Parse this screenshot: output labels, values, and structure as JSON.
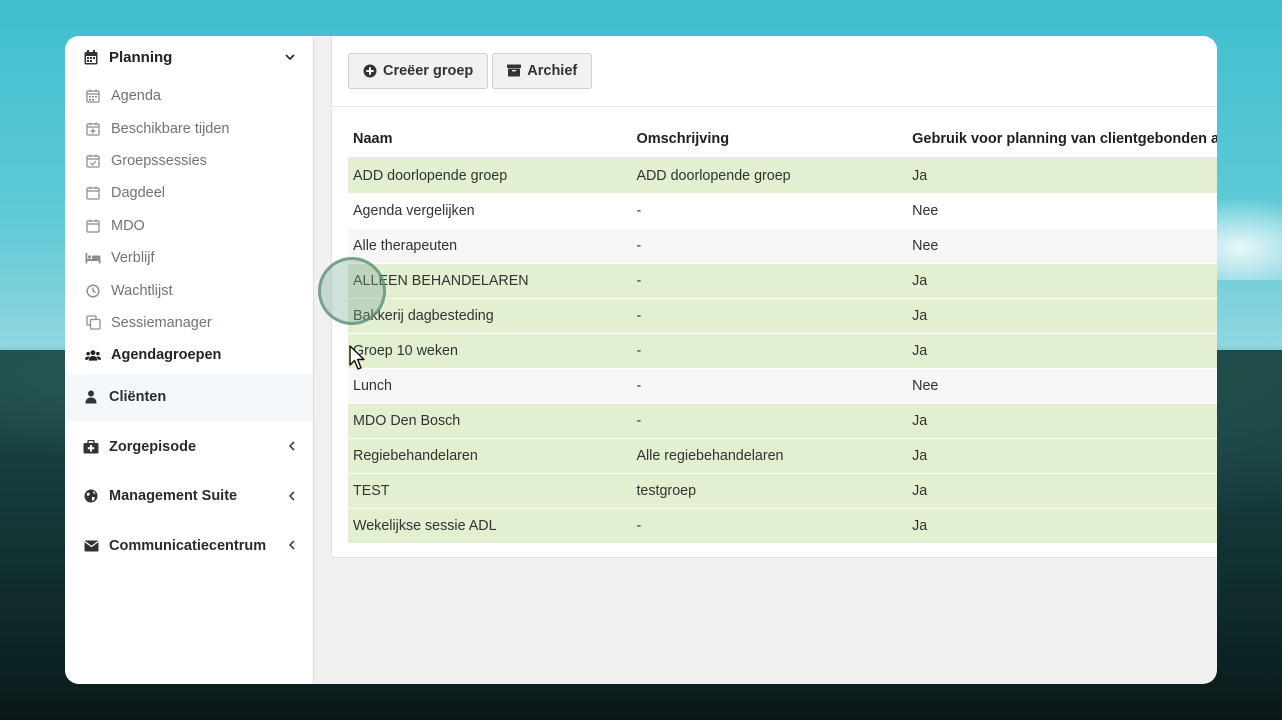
{
  "sidebar": {
    "section": {
      "label": "Planning",
      "icon": "calendar-icon"
    },
    "sub_items": [
      {
        "label": "Agenda",
        "icon": "calendar-icon"
      },
      {
        "label": "Beschikbare tijden",
        "icon": "calendar-plus-icon"
      },
      {
        "label": "Groepssessies",
        "icon": "calendar-check-icon"
      },
      {
        "label": "Dagdeel",
        "icon": "calendar-blank-icon"
      },
      {
        "label": "MDO",
        "icon": "calendar-blank-icon"
      },
      {
        "label": "Verblijf",
        "icon": "bed-icon"
      },
      {
        "label": "Wachtlijst",
        "icon": "clock-icon"
      },
      {
        "label": "Sessiemanager",
        "icon": "copy-icon"
      },
      {
        "label": "Agendagroepen",
        "icon": "users-icon",
        "active": true
      }
    ],
    "groups": [
      {
        "label": "Cliënten",
        "icon": "user-icon"
      },
      {
        "label": "Zorgepisode",
        "icon": "medkit-icon"
      },
      {
        "label": "Management Suite",
        "icon": "globe-icon"
      },
      {
        "label": "Communicatiecentrum",
        "icon": "envelope-icon"
      }
    ]
  },
  "toolbar": {
    "create_label": "Creëer groep",
    "archive_label": "Archief"
  },
  "table": {
    "headers": [
      "Naam",
      "Omschrijving",
      "Gebruik voor planning van clientgebonden afs"
    ],
    "rows": [
      {
        "naam": "ADD doorlopende groep",
        "omschrijving": "ADD doorlopende groep",
        "gebruik": "Ja"
      },
      {
        "naam": "Agenda vergelijken",
        "omschrijving": "-",
        "gebruik": "Nee"
      },
      {
        "naam": "Alle therapeuten",
        "omschrijving": "-",
        "gebruik": "Nee"
      },
      {
        "naam": "ALLEEN BEHANDELAREN",
        "omschrijving": "-",
        "gebruik": "Ja"
      },
      {
        "naam": "Bakkerij dagbesteding",
        "omschrijving": "-",
        "gebruik": "Ja"
      },
      {
        "naam": "Groep 10 weken",
        "omschrijving": "-",
        "gebruik": "Ja"
      },
      {
        "naam": "Lunch",
        "omschrijving": "-",
        "gebruik": "Nee"
      },
      {
        "naam": "MDO Den Bosch",
        "omschrijving": "-",
        "gebruik": "Ja"
      },
      {
        "naam": "Regiebehandelaren",
        "omschrijving": "Alle regiebehandelaren",
        "gebruik": "Ja"
      },
      {
        "naam": "TEST",
        "omschrijving": "testgroep",
        "gebruik": "Ja"
      },
      {
        "naam": "Wekelijkse sessie ADL",
        "omschrijving": "-",
        "gebruik": "Ja"
      }
    ]
  },
  "colors": {
    "row_highlight": "#e2efd0",
    "row_alt": "#f6f6f6"
  }
}
